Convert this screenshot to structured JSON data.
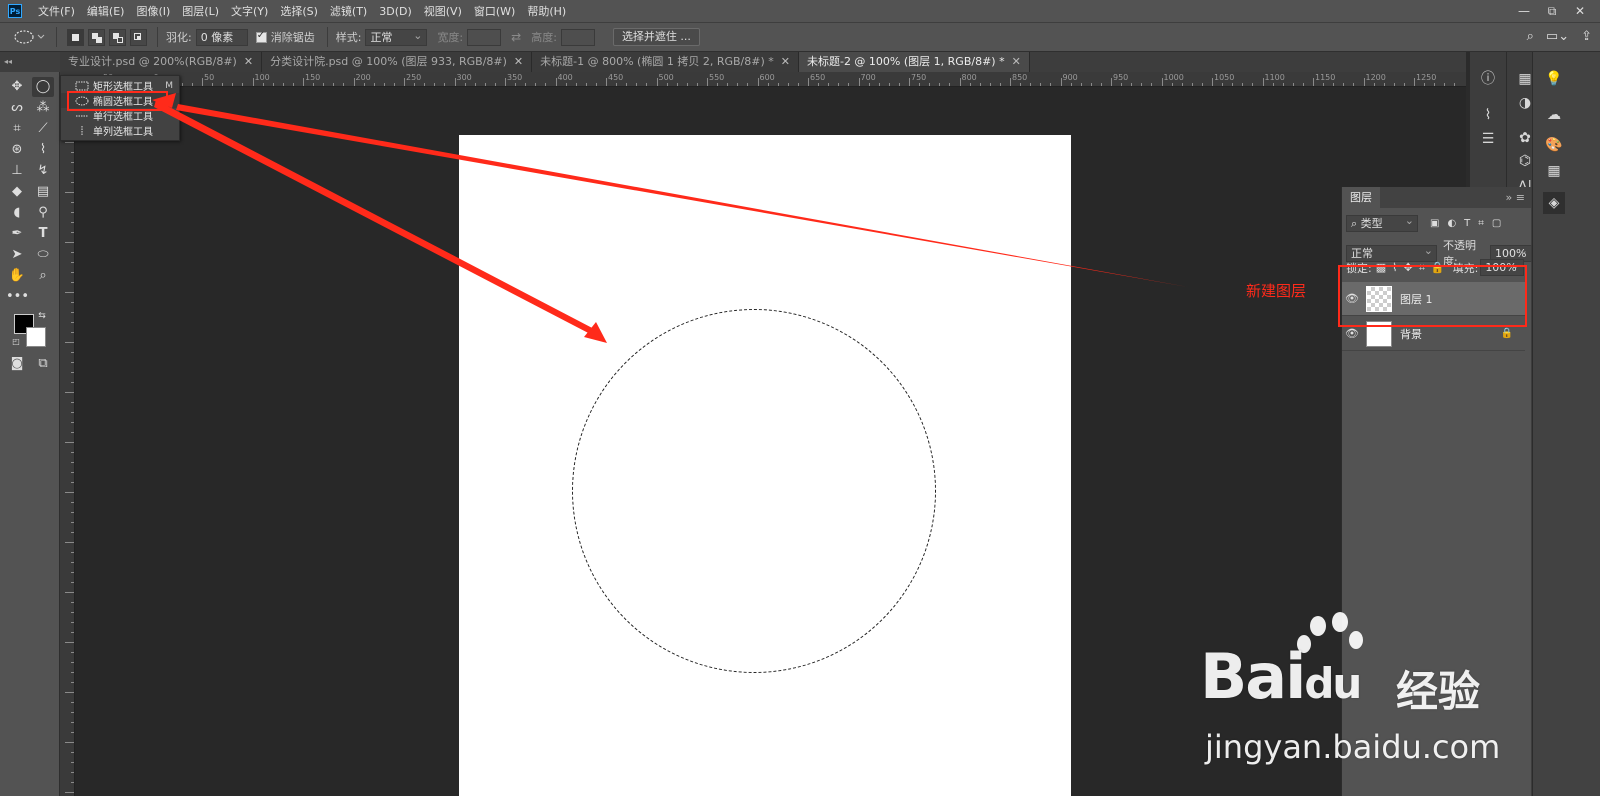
{
  "menubar": {
    "logo": "Ps",
    "items": [
      "文件(F)",
      "编辑(E)",
      "图像(I)",
      "图层(L)",
      "文字(Y)",
      "选择(S)",
      "滤镜(T)",
      "3D(D)",
      "视图(V)",
      "窗口(W)",
      "帮助(H)"
    ],
    "window_controls": [
      "—",
      "⧉",
      "✕"
    ]
  },
  "options": {
    "feather_label": "羽化:",
    "feather_value": "0 像素",
    "antialias_label": "消除锯齿",
    "style_label": "样式:",
    "style_value": "正常",
    "width_label": "宽度:",
    "height_label": "高度:",
    "select_mask_button": "选择并遮住 ..."
  },
  "tabs": [
    {
      "label": "专业设计.psd @ 200%(RGB/8#)",
      "close": "✕",
      "active": false
    },
    {
      "label": "分类设计院.psd @ 100% (图层 933, RGB/8#)",
      "close": "✕",
      "active": false
    },
    {
      "label": "未标题-1 @ 800% (椭圆 1 拷贝 2, RGB/8#) *",
      "close": "✕",
      "active": false
    },
    {
      "label": "未标题-2 @ 100% (图层 1, RGB/8#) *",
      "close": "✕",
      "active": true
    }
  ],
  "ruler": {
    "h_labels": [
      "50",
      "0",
      "50",
      "100",
      "150",
      "200",
      "250",
      "300",
      "350",
      "400",
      "450",
      "500",
      "550",
      "600",
      "650",
      "700",
      "750",
      "800",
      "850",
      "900",
      "950",
      "1000",
      "1050",
      "1100",
      "1150",
      "1200",
      "1250"
    ]
  },
  "flyout": {
    "items": [
      {
        "label": "矩形选框工具",
        "key": "M"
      },
      {
        "label": "椭圆选框工具",
        "key": "M"
      },
      {
        "label": "单行选框工具",
        "key": ""
      },
      {
        "label": "单列选框工具",
        "key": ""
      }
    ]
  },
  "layers_panel": {
    "title": "图层",
    "filter_value": "类型",
    "blend_mode": "正常",
    "opacity_label": "不透明度:",
    "opacity_value": "100%",
    "lock_label": "锁定:",
    "fill_label": "填充:",
    "fill_value": "100%",
    "layers": [
      {
        "name": "图层 1",
        "selected": true
      },
      {
        "name": "背景",
        "selected": false
      }
    ]
  },
  "annotation": {
    "text": "新建图层",
    "color": "#ff2a1a"
  },
  "watermark": {
    "brand": "Bai",
    "brand_du": "du",
    "cn": "经验",
    "url": "jingyan.baidu.com"
  }
}
